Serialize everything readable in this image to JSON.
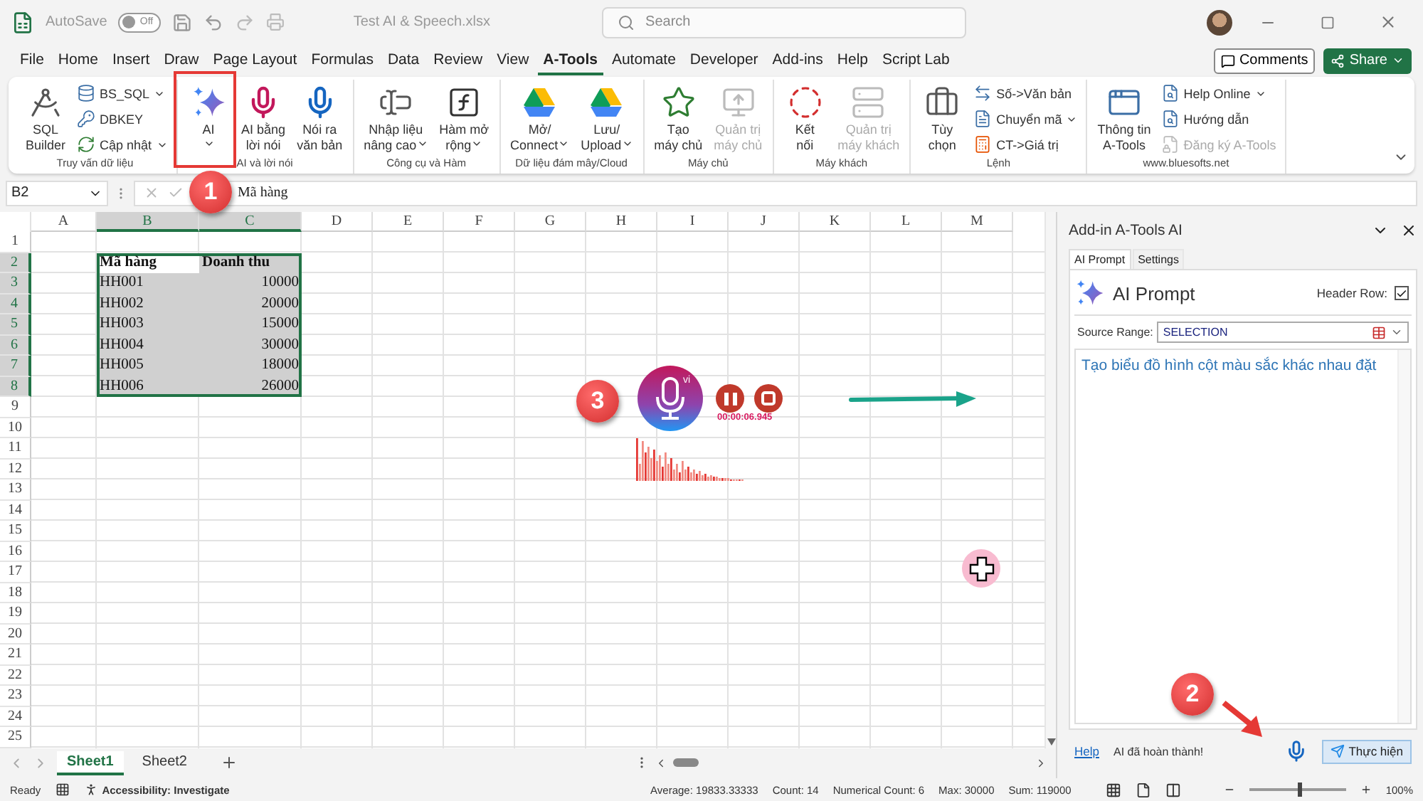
{
  "title_bar": {
    "autosave_label": "AutoSave",
    "autosave_toggle": {
      "label": "Off",
      "on": false
    },
    "file_name": "Test AI & Speech.xlsx",
    "search": {
      "placeholder": "Search"
    }
  },
  "menu_tabs": [
    {
      "label": "File",
      "selected": false
    },
    {
      "label": "Home",
      "selected": false
    },
    {
      "label": "Insert",
      "selected": false
    },
    {
      "label": "Draw",
      "selected": false
    },
    {
      "label": "Page Layout",
      "selected": false
    },
    {
      "label": "Formulas",
      "selected": false
    },
    {
      "label": "Data",
      "selected": false
    },
    {
      "label": "Review",
      "selected": false
    },
    {
      "label": "View",
      "selected": false
    },
    {
      "label": "A-Tools",
      "selected": true
    },
    {
      "label": "Automate",
      "selected": false
    },
    {
      "label": "Developer",
      "selected": false
    },
    {
      "label": "Add-ins",
      "selected": false
    },
    {
      "label": "Help",
      "selected": false
    },
    {
      "label": "Script Lab",
      "selected": false
    }
  ],
  "menu_actions": {
    "comments": "Comments",
    "share": "Share"
  },
  "ribbon_groups": [
    {
      "label": "Truy vấn dữ liệu",
      "buttons": [
        {
          "kind": "large",
          "lines": [
            "SQL",
            "Builder"
          ],
          "dropdown": false,
          "disabled": false
        },
        {
          "kind": "small",
          "lines": [
            "BS_SQL"
          ],
          "dropdown": true,
          "disabled": false
        },
        {
          "kind": "small",
          "lines": [
            "DBKEY"
          ],
          "dropdown": false,
          "disabled": false
        },
        {
          "kind": "small",
          "lines": [
            "Cập nhật"
          ],
          "dropdown": true,
          "disabled": false
        }
      ]
    },
    {
      "label": "AI và lời nói",
      "buttons": [
        {
          "kind": "large",
          "lines": [
            "AI"
          ],
          "dropdown": true,
          "disabled": false
        },
        {
          "kind": "large",
          "lines": [
            "AI bằng",
            "lời nói"
          ],
          "dropdown": false,
          "disabled": false
        },
        {
          "kind": "large",
          "lines": [
            "Nói ra",
            "văn bản"
          ],
          "dropdown": false,
          "disabled": false
        }
      ]
    },
    {
      "label": "Công cụ và Hàm",
      "buttons": [
        {
          "kind": "large",
          "lines": [
            "Nhập liệu",
            "nâng cao"
          ],
          "dropdown": true,
          "disabled": false
        },
        {
          "kind": "large",
          "lines": [
            "Hàm mở",
            "rộng"
          ],
          "dropdown": true,
          "disabled": false
        }
      ]
    },
    {
      "label": "Dữ liệu đám mây/Cloud",
      "buttons": [
        {
          "kind": "large",
          "lines": [
            "Mở/",
            "Connect"
          ],
          "dropdown": true,
          "disabled": false
        },
        {
          "kind": "large",
          "lines": [
            "Lưu/",
            "Upload"
          ],
          "dropdown": true,
          "disabled": false
        }
      ]
    },
    {
      "label": "Máy chủ",
      "buttons": [
        {
          "kind": "large",
          "lines": [
            "Tạo",
            "máy chủ"
          ],
          "dropdown": false,
          "disabled": false
        },
        {
          "kind": "large",
          "lines": [
            "Quản trị",
            "máy chủ"
          ],
          "dropdown": false,
          "disabled": true
        }
      ]
    },
    {
      "label": "Máy khách",
      "buttons": [
        {
          "kind": "large",
          "lines": [
            "Kết",
            "nối"
          ],
          "dropdown": false,
          "disabled": false
        },
        {
          "kind": "large",
          "lines": [
            "Quản trị",
            "máy khách"
          ],
          "dropdown": false,
          "disabled": true
        }
      ]
    },
    {
      "label": "Lệnh",
      "buttons": [
        {
          "kind": "large",
          "lines": [
            "Tùy",
            "chọn"
          ],
          "dropdown": false,
          "disabled": false
        },
        {
          "kind": "small",
          "lines": [
            "Số->Văn bản"
          ],
          "dropdown": false,
          "disabled": false
        },
        {
          "kind": "small",
          "lines": [
            "Chuyển mã"
          ],
          "dropdown": true,
          "disabled": false
        },
        {
          "kind": "small",
          "lines": [
            "CT->Giá trị"
          ],
          "dropdown": false,
          "disabled": false
        }
      ]
    },
    {
      "label": "www.bluesofts.net",
      "buttons": [
        {
          "kind": "large",
          "lines": [
            "Thông tin",
            "A-Tools"
          ],
          "dropdown": false,
          "disabled": false
        },
        {
          "kind": "small",
          "lines": [
            "Help Online"
          ],
          "dropdown": true,
          "disabled": false
        },
        {
          "kind": "small",
          "lines": [
            "Hướng dẫn"
          ],
          "dropdown": false,
          "disabled": false
        },
        {
          "kind": "small",
          "lines": [
            "Đăng ký A-Tools"
          ],
          "dropdown": false,
          "disabled": true
        }
      ]
    }
  ],
  "formula_bar": {
    "name_box": "B2",
    "value": "Mã hàng"
  },
  "sheet": {
    "columns": [
      {
        "label": "A",
        "selected": false
      },
      {
        "label": "B",
        "selected": true
      },
      {
        "label": "C",
        "selected": true
      },
      {
        "label": "D",
        "selected": false
      },
      {
        "label": "E",
        "selected": false
      },
      {
        "label": "F",
        "selected": false
      },
      {
        "label": "G",
        "selected": false
      },
      {
        "label": "H",
        "selected": false
      },
      {
        "label": "I",
        "selected": false
      },
      {
        "label": "J",
        "selected": false
      },
      {
        "label": "K",
        "selected": false
      },
      {
        "label": "L",
        "selected": false
      },
      {
        "label": "M",
        "selected": false
      }
    ],
    "rows": [
      {
        "header": "1",
        "selected": false,
        "active": false
      },
      {
        "header": "2",
        "kind": "header",
        "values": [
          "Mã hàng",
          "Doanh thu"
        ],
        "selected": true,
        "active": true
      },
      {
        "header": "3",
        "kind": "data",
        "values": [
          "HH001",
          "10000"
        ],
        "selected": true,
        "active": false
      },
      {
        "header": "4",
        "kind": "data",
        "values": [
          "HH002",
          "20000"
        ],
        "selected": true,
        "active": false
      },
      {
        "header": "5",
        "kind": "data",
        "values": [
          "HH003",
          "15000"
        ],
        "selected": true,
        "active": false
      },
      {
        "header": "6",
        "kind": "data",
        "values": [
          "HH004",
          "30000"
        ],
        "selected": true,
        "active": false
      },
      {
        "header": "7",
        "kind": "data",
        "values": [
          "HH005",
          "18000"
        ],
        "selected": true,
        "active": false
      },
      {
        "header": "8",
        "kind": "data",
        "values": [
          "HH006",
          "26000"
        ],
        "selected": true,
        "active": false
      },
      {
        "header": "9",
        "selected": false,
        "active": false
      },
      {
        "header": "10",
        "selected": false,
        "active": false
      },
      {
        "header": "11",
        "selected": false,
        "active": false
      },
      {
        "header": "12",
        "selected": false,
        "active": false
      },
      {
        "header": "13",
        "selected": false,
        "active": false
      },
      {
        "header": "14",
        "selected": false,
        "active": false
      },
      {
        "header": "15",
        "selected": false,
        "active": false
      },
      {
        "header": "16",
        "selected": false,
        "active": false
      },
      {
        "header": "17",
        "selected": false,
        "active": false
      },
      {
        "header": "18",
        "selected": false,
        "active": false
      },
      {
        "header": "19",
        "selected": false,
        "active": false
      },
      {
        "header": "20",
        "selected": false,
        "active": false
      },
      {
        "header": "21",
        "selected": false,
        "active": false
      },
      {
        "header": "22",
        "selected": false,
        "active": false
      },
      {
        "header": "23",
        "selected": false,
        "active": false
      },
      {
        "header": "24",
        "selected": false,
        "active": false
      },
      {
        "header": "25",
        "selected": false,
        "active": false
      }
    ]
  },
  "sheet_tabs": [
    {
      "label": "Sheet1",
      "selected": true
    },
    {
      "label": "Sheet2",
      "selected": false
    }
  ],
  "recorder": {
    "language": "vi",
    "timer": "00:00:06.945"
  },
  "annotations": [
    "1",
    "2",
    "3"
  ],
  "task_pane": {
    "title": "Add-in A-Tools AI",
    "tabs": [
      {
        "label": "AI Prompt",
        "selected": true
      },
      {
        "label": "Settings",
        "selected": false
      }
    ],
    "heading": "AI Prompt",
    "header_row": {
      "label": "Header Row:",
      "checked": true
    },
    "source_range": {
      "label": "Source Range:",
      "value": "SELECTION"
    },
    "prompt": "Tạo biểu đồ hình cột màu sắc khác nhau đặt",
    "help_link": "Help",
    "status": "AI đã hoàn thành!",
    "run_button": "Thực hiện"
  },
  "status_bar": {
    "ready": "Ready",
    "accessibility": "Accessibility: Investigate",
    "stats": [
      "Average: 19833.33333",
      "Count: 14",
      "Numerical Count: 6",
      "Max: 30000",
      "Sum: 119000"
    ],
    "zoom": {
      "label": "100%",
      "level": 0.5
    }
  }
}
